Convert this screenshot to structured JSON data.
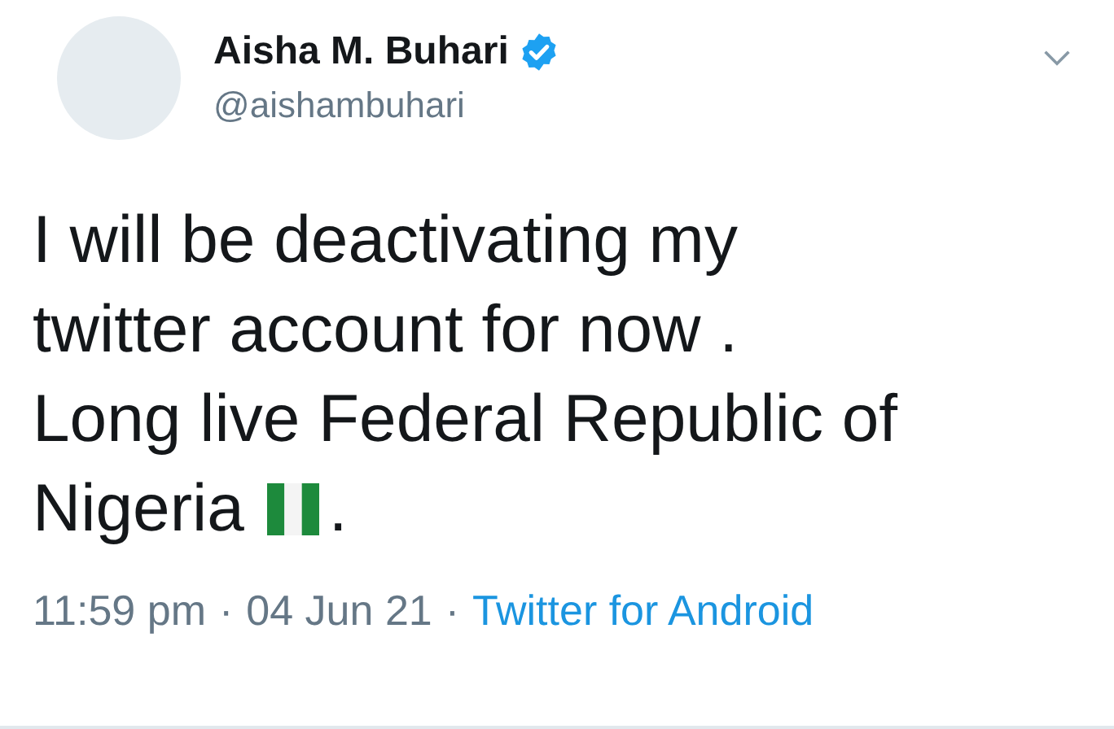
{
  "author": {
    "name": "Aisha M. Buhari",
    "verified": true,
    "handle": "@aishambuhari"
  },
  "tweet": {
    "lines": [
      "I will be deactivating my",
      "twitter account for now .",
      "Long live Federal Republic of",
      "Nigeria"
    ],
    "after_flag": "."
  },
  "meta": {
    "time": "11:59 pm",
    "separator_1": "·",
    "date": "04 Jun 21",
    "separator_2": "·",
    "source": "Twitter for Android"
  }
}
